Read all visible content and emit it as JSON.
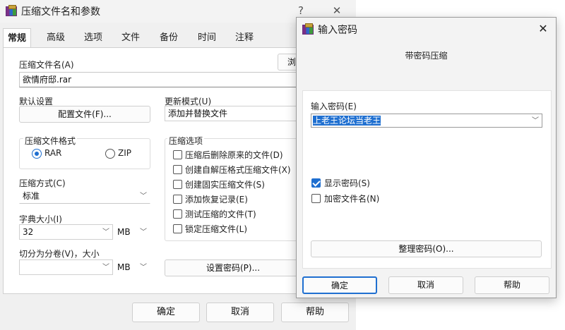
{
  "main_window": {
    "title": "压缩文件名和参数",
    "help_glyph": "?",
    "close_glyph": "✕",
    "tabs": [
      "常规",
      "高级",
      "选项",
      "文件",
      "备份",
      "时间",
      "注释"
    ],
    "archive_name_label": "压缩文件名(A)",
    "archive_name_value": "欲情府邸.rar",
    "browse_label": "浏",
    "default_settings_label": "默认设置",
    "config_button": "配置文件(F)...",
    "update_mode_label": "更新模式(U)",
    "update_mode_value": "添加并替换文件",
    "format_group_label": "压缩文件格式",
    "format_rar": "RAR",
    "format_zip": "ZIP",
    "method_label": "压缩方式(C)",
    "method_value": "标准",
    "dict_label": "字典大小(I)",
    "dict_value": "32",
    "dict_unit": "MB",
    "split_label": "切分为分卷(V)，大小",
    "split_value": "",
    "split_unit": "MB",
    "options_group_label": "压缩选项",
    "options": [
      {
        "label": "压缩后删除原来的文件(D)",
        "checked": false
      },
      {
        "label": "创建自解压格式压缩文件(X)",
        "checked": false
      },
      {
        "label": "创建固实压缩文件(S)",
        "checked": false
      },
      {
        "label": "添加恢复记录(E)",
        "checked": false
      },
      {
        "label": "测试压缩的文件(T)",
        "checked": false
      },
      {
        "label": "锁定压缩文件(L)",
        "checked": false
      }
    ],
    "set_password_button": "设置密码(P)...",
    "ok_button": "确定",
    "cancel_button": "取消",
    "help_button": "帮助"
  },
  "password_dialog": {
    "title": "输入密码",
    "close_glyph": "✕",
    "subtitle": "带密码压缩",
    "password_label": "输入密码(E)",
    "password_value": "上老王论坛当老王",
    "show_password_label": "显示密码(S)",
    "show_password_checked": true,
    "encrypt_names_label": "加密文件名(N)",
    "encrypt_names_checked": false,
    "organize_button": "整理密码(O)...",
    "ok_button": "确定",
    "cancel_button": "取消",
    "help_button": "帮助"
  },
  "colors": {
    "accent": "#1f6fd0",
    "selection": "#1f6fd0"
  },
  "icons": [
    "winrar-icon",
    "help-icon",
    "close-icon",
    "chevron-down-icon",
    "checkbox-icon",
    "radio-icon"
  ]
}
